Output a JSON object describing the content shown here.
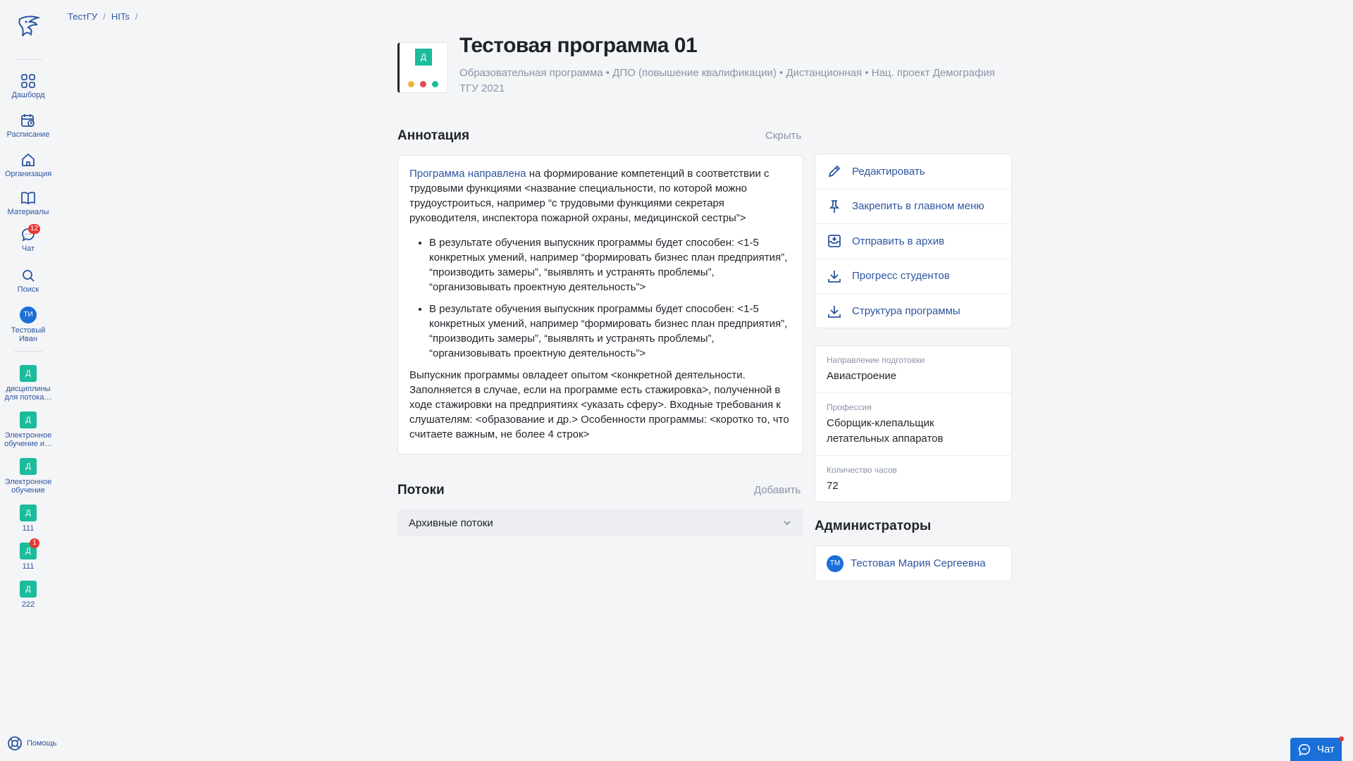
{
  "breadcrumb": {
    "items": [
      "ТестГУ",
      "HITs"
    ],
    "separator": "/"
  },
  "sidebar": {
    "nav": [
      {
        "label": "Дашборд",
        "icon": "grid-icon"
      },
      {
        "label": "Расписание",
        "icon": "calendar-icon"
      },
      {
        "label": "Организация",
        "icon": "home-icon"
      },
      {
        "label": "Материалы",
        "icon": "book-icon"
      },
      {
        "label": "Чат",
        "icon": "chat-icon",
        "badge": "12"
      },
      {
        "label": "Поиск",
        "icon": "search-icon"
      }
    ],
    "user": {
      "initials": "ТИ",
      "label": "Тестовый Иван"
    },
    "programs": [
      {
        "icon_letter": "Д",
        "label": "дисциплины для потока…"
      },
      {
        "icon_letter": "Д",
        "label": "Электронное обучение и…"
      },
      {
        "icon_letter": "Д",
        "label": "Электронное обучение"
      },
      {
        "icon_letter": "Д",
        "label": "111"
      },
      {
        "icon_letter": "Д",
        "label": "111",
        "badge": "1"
      },
      {
        "icon_letter": "Д",
        "label": "222"
      }
    ],
    "help_label": "Помощь"
  },
  "header": {
    "cover_letter": "Д",
    "title": "Тестовая программа 01",
    "subtitle": "Образовательная программа • ДПО (повышение квалификации) • Дистанционная • Нац. проект Демография ТГУ 2021"
  },
  "annotation": {
    "heading": "Аннотация",
    "toggle_label": "Скрыть",
    "intro_link": "Программа направлена",
    "intro_rest": " на формирование компетенций в соответствии с трудовыми функциями <название специальности, по которой можно трудоустроиться, например “с трудовыми функциями секретаря руководителя, инспектора пожарной охраны, медицинской сестры”>",
    "bullets": [
      "В результате обучения выпускник программы будет способен: <1-5 конкретных умений, например “формировать бизнес план предприятия”, “производить замеры”, “выявлять и устранять проблемы”, “организовывать проектную деятельность”>",
      "В результате обучения выпускник программы будет способен: <1-5 конкретных умений, например “формировать бизнес план предприятия”, “производить замеры”, “выявлять и устранять проблемы”, “организовывать проектную деятельность”>"
    ],
    "outro": "Выпускник программы овладеет опытом <конкретной деятельности. Заполняется в случае, если на программе есть стажировка>, полученной в ходе стажировки на предприятиях <указать сферу>. Входные требования к слушателям: <образование и др.> Особенности программы: <коротко то, что считаете важным, не более 4 строк>"
  },
  "streams": {
    "heading": "Потоки",
    "add_label": "Добавить",
    "archived_label": "Архивные потоки"
  },
  "actions": [
    {
      "label": "Редактировать",
      "icon": "pencil-icon"
    },
    {
      "label": "Закрепить в главном меню",
      "icon": "pin-icon"
    },
    {
      "label": "Отправить в архив",
      "icon": "archive-icon"
    },
    {
      "label": "Прогресс студентов",
      "icon": "download-icon"
    },
    {
      "label": "Структура программы",
      "icon": "download-icon"
    }
  ],
  "info": {
    "direction_label": "Направление подготовки",
    "direction_value": "Авиастроение",
    "profession_label": "Профессия",
    "profession_value": "Сборщик-клепальщик летательных аппаратов",
    "hours_label": "Количество часов",
    "hours_value": "72"
  },
  "admins": {
    "heading": "Администраторы",
    "list": [
      {
        "initials": "ТМ",
        "name": "Тестовая Мария Сергеевна"
      }
    ]
  },
  "chat_button": {
    "label": "Чат"
  },
  "colors": {
    "accent": "#2d55a0",
    "primary": "#1b6fd8",
    "program_icon": "#1abc9c",
    "badge": "#e53935"
  }
}
